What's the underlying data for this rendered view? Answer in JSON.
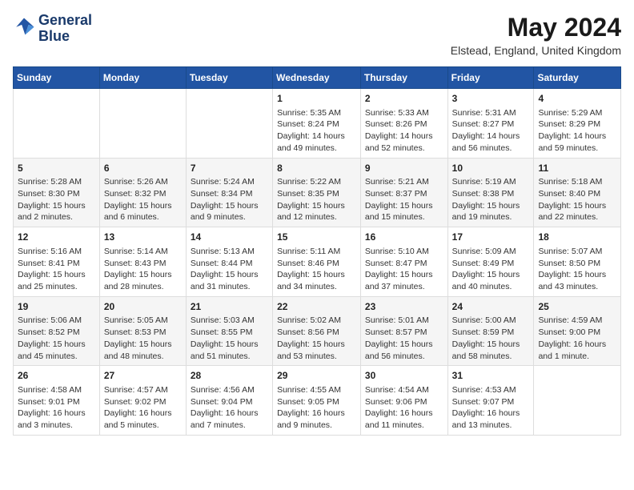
{
  "header": {
    "logo_line1": "General",
    "logo_line2": "Blue",
    "month": "May 2024",
    "location": "Elstead, England, United Kingdom"
  },
  "calendar": {
    "days_of_week": [
      "Sunday",
      "Monday",
      "Tuesday",
      "Wednesday",
      "Thursday",
      "Friday",
      "Saturday"
    ],
    "weeks": [
      [
        {
          "day": "",
          "info": ""
        },
        {
          "day": "",
          "info": ""
        },
        {
          "day": "",
          "info": ""
        },
        {
          "day": "1",
          "info": "Sunrise: 5:35 AM\nSunset: 8:24 PM\nDaylight: 14 hours\nand 49 minutes."
        },
        {
          "day": "2",
          "info": "Sunrise: 5:33 AM\nSunset: 8:26 PM\nDaylight: 14 hours\nand 52 minutes."
        },
        {
          "day": "3",
          "info": "Sunrise: 5:31 AM\nSunset: 8:27 PM\nDaylight: 14 hours\nand 56 minutes."
        },
        {
          "day": "4",
          "info": "Sunrise: 5:29 AM\nSunset: 8:29 PM\nDaylight: 14 hours\nand 59 minutes."
        }
      ],
      [
        {
          "day": "5",
          "info": "Sunrise: 5:28 AM\nSunset: 8:30 PM\nDaylight: 15 hours\nand 2 minutes."
        },
        {
          "day": "6",
          "info": "Sunrise: 5:26 AM\nSunset: 8:32 PM\nDaylight: 15 hours\nand 6 minutes."
        },
        {
          "day": "7",
          "info": "Sunrise: 5:24 AM\nSunset: 8:34 PM\nDaylight: 15 hours\nand 9 minutes."
        },
        {
          "day": "8",
          "info": "Sunrise: 5:22 AM\nSunset: 8:35 PM\nDaylight: 15 hours\nand 12 minutes."
        },
        {
          "day": "9",
          "info": "Sunrise: 5:21 AM\nSunset: 8:37 PM\nDaylight: 15 hours\nand 15 minutes."
        },
        {
          "day": "10",
          "info": "Sunrise: 5:19 AM\nSunset: 8:38 PM\nDaylight: 15 hours\nand 19 minutes."
        },
        {
          "day": "11",
          "info": "Sunrise: 5:18 AM\nSunset: 8:40 PM\nDaylight: 15 hours\nand 22 minutes."
        }
      ],
      [
        {
          "day": "12",
          "info": "Sunrise: 5:16 AM\nSunset: 8:41 PM\nDaylight: 15 hours\nand 25 minutes."
        },
        {
          "day": "13",
          "info": "Sunrise: 5:14 AM\nSunset: 8:43 PM\nDaylight: 15 hours\nand 28 minutes."
        },
        {
          "day": "14",
          "info": "Sunrise: 5:13 AM\nSunset: 8:44 PM\nDaylight: 15 hours\nand 31 minutes."
        },
        {
          "day": "15",
          "info": "Sunrise: 5:11 AM\nSunset: 8:46 PM\nDaylight: 15 hours\nand 34 minutes."
        },
        {
          "day": "16",
          "info": "Sunrise: 5:10 AM\nSunset: 8:47 PM\nDaylight: 15 hours\nand 37 minutes."
        },
        {
          "day": "17",
          "info": "Sunrise: 5:09 AM\nSunset: 8:49 PM\nDaylight: 15 hours\nand 40 minutes."
        },
        {
          "day": "18",
          "info": "Sunrise: 5:07 AM\nSunset: 8:50 PM\nDaylight: 15 hours\nand 43 minutes."
        }
      ],
      [
        {
          "day": "19",
          "info": "Sunrise: 5:06 AM\nSunset: 8:52 PM\nDaylight: 15 hours\nand 45 minutes."
        },
        {
          "day": "20",
          "info": "Sunrise: 5:05 AM\nSunset: 8:53 PM\nDaylight: 15 hours\nand 48 minutes."
        },
        {
          "day": "21",
          "info": "Sunrise: 5:03 AM\nSunset: 8:55 PM\nDaylight: 15 hours\nand 51 minutes."
        },
        {
          "day": "22",
          "info": "Sunrise: 5:02 AM\nSunset: 8:56 PM\nDaylight: 15 hours\nand 53 minutes."
        },
        {
          "day": "23",
          "info": "Sunrise: 5:01 AM\nSunset: 8:57 PM\nDaylight: 15 hours\nand 56 minutes."
        },
        {
          "day": "24",
          "info": "Sunrise: 5:00 AM\nSunset: 8:59 PM\nDaylight: 15 hours\nand 58 minutes."
        },
        {
          "day": "25",
          "info": "Sunrise: 4:59 AM\nSunset: 9:00 PM\nDaylight: 16 hours\nand 1 minute."
        }
      ],
      [
        {
          "day": "26",
          "info": "Sunrise: 4:58 AM\nSunset: 9:01 PM\nDaylight: 16 hours\nand 3 minutes."
        },
        {
          "day": "27",
          "info": "Sunrise: 4:57 AM\nSunset: 9:02 PM\nDaylight: 16 hours\nand 5 minutes."
        },
        {
          "day": "28",
          "info": "Sunrise: 4:56 AM\nSunset: 9:04 PM\nDaylight: 16 hours\nand 7 minutes."
        },
        {
          "day": "29",
          "info": "Sunrise: 4:55 AM\nSunset: 9:05 PM\nDaylight: 16 hours\nand 9 minutes."
        },
        {
          "day": "30",
          "info": "Sunrise: 4:54 AM\nSunset: 9:06 PM\nDaylight: 16 hours\nand 11 minutes."
        },
        {
          "day": "31",
          "info": "Sunrise: 4:53 AM\nSunset: 9:07 PM\nDaylight: 16 hours\nand 13 minutes."
        },
        {
          "day": "",
          "info": ""
        }
      ]
    ]
  }
}
